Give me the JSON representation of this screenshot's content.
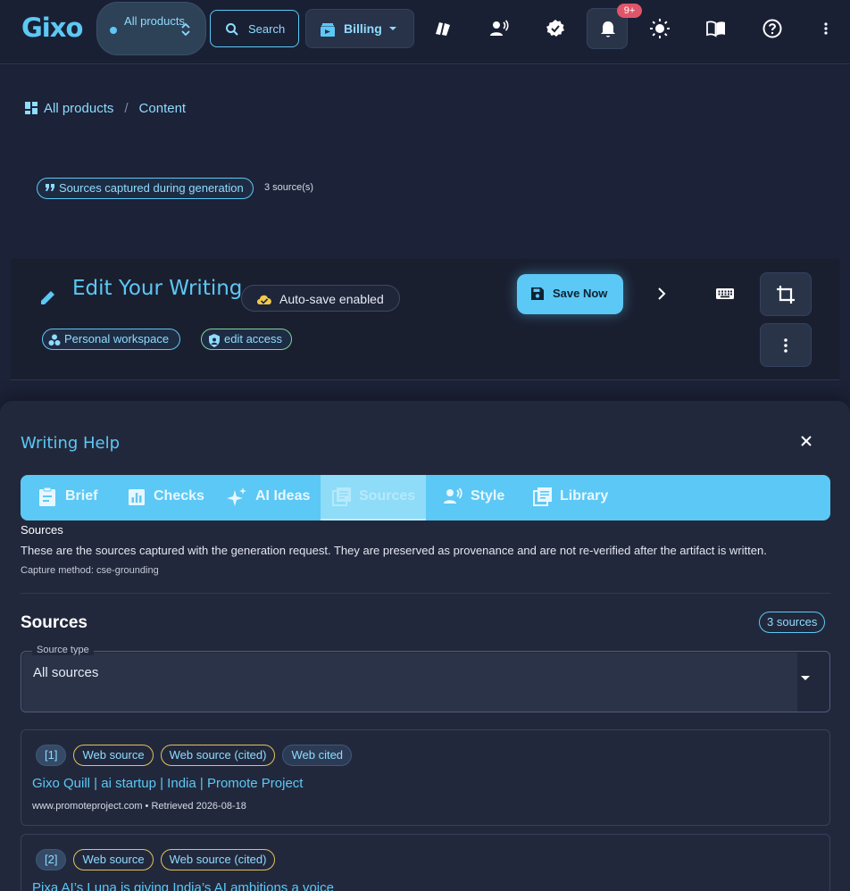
{
  "app": {
    "logo": "Gixo",
    "product_selector": "All products",
    "search_label": "Search",
    "billing_label": "Billing",
    "notification_badge": "9+"
  },
  "breadcrumb": {
    "root": "All products",
    "separator": "/",
    "current": "Content"
  },
  "sources_chip": {
    "label": "Sources captured during generation",
    "count": "3 source(s)"
  },
  "editor": {
    "title": "Edit Your Writing",
    "autosave": "Auto-save enabled",
    "workspace": "Personal workspace",
    "access": "edit access",
    "save_label": "Save Now"
  },
  "writing_help": {
    "title": "Writing Help",
    "tabs": [
      {
        "label": "Brief",
        "icon": "clipboard-icon"
      },
      {
        "label": "Checks",
        "icon": "bar-chart-icon"
      },
      {
        "label": "AI Ideas",
        "icon": "sparkle-icon"
      },
      {
        "label": "Sources",
        "icon": "library-icon",
        "active": true
      },
      {
        "label": "Style",
        "icon": "voice-icon"
      },
      {
        "label": "Library",
        "icon": "book-stack-icon"
      }
    ],
    "section_label": "Sources",
    "description": "These are the sources captured with the generation request. They are preserved as provenance and are not re-verified after the artifact is written.",
    "capture_method": "Capture method: cse-grounding",
    "sources_heading": "Sources",
    "sources_count": "3 sources",
    "filter": {
      "label": "Source type",
      "value": "All sources"
    },
    "sources": [
      {
        "index": "[1]",
        "tags": [
          "Web source",
          "Web source (cited)",
          "Web cited"
        ],
        "title": "Gixo Quill | ai startup | India | Promote Project",
        "meta": "www.promoteproject.com • Retrieved 2026-08-18"
      },
      {
        "index": "[2]",
        "tags": [
          "Web source",
          "Web source (cited)"
        ],
        "title": "Pixa AI’s Luna is giving India’s AI ambitions a voice",
        "meta": ""
      }
    ]
  },
  "colors": {
    "accent": "#5cc8f5",
    "background": "#1c2237",
    "warning_outline": "#e3c25a",
    "badge": "#e1556a"
  }
}
